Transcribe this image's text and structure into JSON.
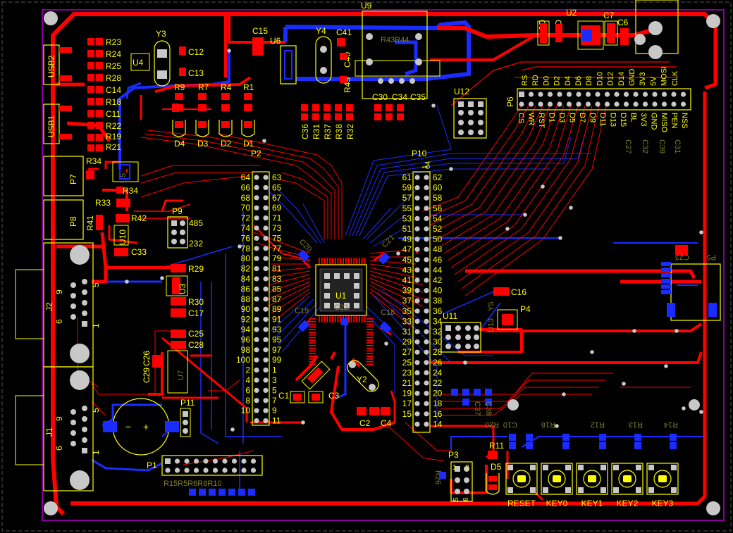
{
  "window": {
    "title": "PCB Layout"
  },
  "colors": {
    "background": "#000000",
    "top_copper": "#ff0000",
    "bottom_copper": "#1a2cff",
    "silkscreen": "#ffff00",
    "bottom_silk": "#7e7e2e",
    "board_outline": "#b000c8",
    "pad": "#c8c8c8",
    "hole": "#0a0a0a",
    "select_highlight": "#ff00ff"
  },
  "components": {
    "usb2": "USB2",
    "usb1": "USB1",
    "r23": "R23",
    "r24": "R24",
    "r25": "R25",
    "r28": "R28",
    "c14": "C14",
    "r18": "R18",
    "c11": "C11",
    "r22": "R22",
    "r19": "R19",
    "r21": "R21",
    "y3": "Y3",
    "u4": "U4",
    "c12": "C12",
    "c13": "C13",
    "c15": "C15",
    "u6": "U6",
    "y4": "Y4",
    "c41": "C41",
    "c40": "C40",
    "r45": "R45",
    "u9": "U9",
    "c30": "C30",
    "c34": "C34",
    "c35": "C35",
    "r9": "R9",
    "r7": "R7",
    "r4": "R4",
    "r1": "R1",
    "d4": "D4",
    "d3": "D3",
    "d2": "D2",
    "d1": "D1",
    "c36": "C36",
    "r31": "R31",
    "r37": "R37",
    "r38": "R38",
    "r32": "R32",
    "c9": "C9",
    "c8": "C8",
    "u2": "U2",
    "c7": "C7",
    "c6": "C6",
    "u12": "U12",
    "p6": "P6",
    "p7": "P7",
    "r34": "R34",
    "r34b": "R34",
    "r33": "R33",
    "p8": "P8",
    "r41": "R41",
    "r42": "R42",
    "u10": "U10",
    "c33": "C33",
    "p9": "P9",
    "p9_485": "485",
    "p9_232": "232",
    "p2": "P2",
    "p10": "P10",
    "u1": "U1",
    "c20": "C20",
    "c21": "C21",
    "c19": "C19",
    "c22": "C22",
    "c18": "C18",
    "r29": "R29",
    "u3": "U3",
    "r30": "R30",
    "c17": "C17",
    "c25": "C25",
    "c28": "C28",
    "c29": "C29",
    "c26": "C26",
    "j2": "J2",
    "j1": "J1",
    "p11": "P11",
    "p1": "P1",
    "c1": "C1",
    "c3": "C3",
    "y2": "Y2",
    "c2": "C2",
    "c4": "C4",
    "c16": "C16",
    "u13": "U13",
    "y5": "Y5",
    "p4": "P4",
    "p5": "P5",
    "c23": "C23",
    "u11": "U11",
    "c37": "C37",
    "c38": "C38",
    "r20": "R20",
    "c10": "C10",
    "r16": "R16",
    "r12": "R12",
    "r13": "R13",
    "r14": "R14",
    "p3": "P3",
    "r11": "R11",
    "d5": "D5",
    "r26": "R26",
    "c27": "C27",
    "c32": "C32",
    "c39": "C39",
    "c31": "C31",
    "u5": "U5",
    "u7": "U7"
  },
  "buttons": {
    "reset": "RESET",
    "key0": "KEY0",
    "key1": "KEY1",
    "key2": "KEY2",
    "key3": "KEY3"
  },
  "p6_top_labels": [
    "RS",
    "RD",
    "D0",
    "D2",
    "D4",
    "D6",
    "D8",
    "D10",
    "D12",
    "D14",
    "GND",
    "3V3",
    "5V",
    "MOSI",
    "CLK"
  ],
  "p6_bottom_labels": [
    "CS",
    "WR",
    "RST",
    "D1",
    "D3",
    "D5",
    "D7",
    "D9",
    "D11",
    "D13",
    "D15",
    "BL",
    "3V3",
    "GND",
    "MISO",
    "PEN",
    "NSS"
  ],
  "p2_left_numbers": [
    "64",
    "66",
    "68",
    "70",
    "72",
    "74",
    "76",
    "78",
    "80",
    "82",
    "84",
    "86",
    "88",
    "90",
    "92",
    "94",
    "96",
    "98",
    "100",
    "2",
    "4",
    "6",
    "8",
    "10"
  ],
  "p2_right_numbers": [
    "63",
    "65",
    "67",
    "69",
    "71",
    "73",
    "75",
    "77",
    "79",
    "81",
    "83",
    "85",
    "87",
    "89",
    "91",
    "93",
    "95",
    "97",
    "99",
    "1",
    "3",
    "5",
    "7",
    "9",
    "11"
  ],
  "p10_left_numbers": [
    "61",
    "59",
    "57",
    "55",
    "53",
    "51",
    "49",
    "47",
    "45",
    "43",
    "41",
    "39",
    "37",
    "35",
    "33",
    "31",
    "29",
    "27",
    "25",
    "23",
    "21",
    "19",
    "17",
    "15"
  ],
  "p10_right_numbers": [
    "62",
    "60",
    "58",
    "56",
    "54",
    "52",
    "50",
    "48",
    "46",
    "44",
    "42",
    "40",
    "38",
    "36",
    "34",
    "32",
    "30",
    "28",
    "26",
    "24",
    "22",
    "20",
    "18",
    "16",
    "14"
  ],
  "p10_top_markers": [
    "1",
    "64"
  ],
  "u9_pins": "R43R44",
  "p1_bottom": "R15R5R6R8R10",
  "j_pins": {
    "five": "5",
    "nine": "9",
    "six": "6",
    "one": "1"
  },
  "p3_pins": {
    "one": "1",
    "two": "2",
    "five": "5",
    "six": "6"
  },
  "misc": {
    "p10_1": "1",
    "p10_2": "2"
  }
}
